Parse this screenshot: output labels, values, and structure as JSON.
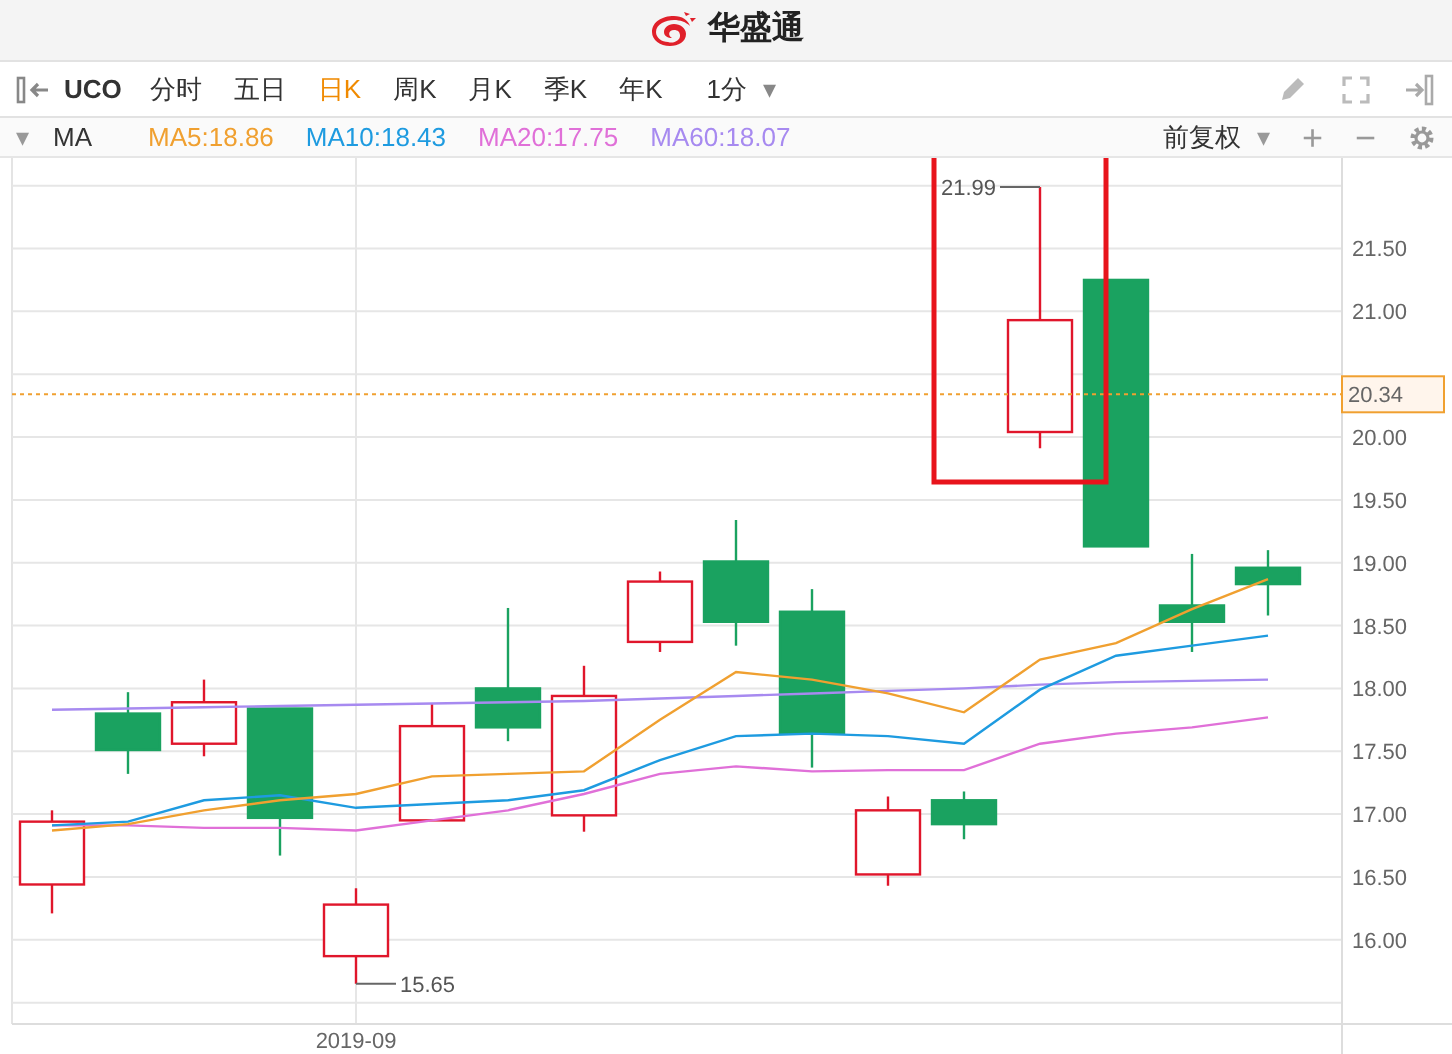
{
  "header": {
    "logo_text": "华盛通"
  },
  "toolbar": {
    "symbol": "UCO",
    "tabs": [
      {
        "label": "分时",
        "selected": false
      },
      {
        "label": "五日",
        "selected": false
      },
      {
        "label": "日K",
        "selected": true
      },
      {
        "label": "周K",
        "selected": false
      },
      {
        "label": "月K",
        "selected": false
      },
      {
        "label": "季K",
        "selected": false
      },
      {
        "label": "年K",
        "selected": false
      }
    ],
    "interval": "1分",
    "interval_caret": "▾"
  },
  "indicator_bar": {
    "caret": "▾",
    "name": "MA",
    "legend_values": [
      ":18.86",
      ":18.43",
      ":17.75",
      ":18.07"
    ],
    "adjust": "前复权",
    "adjust_caret": "▾",
    "plus": "+",
    "minus": "−"
  },
  "chart": {
    "date_label": "2019-09",
    "high_label": "21.99",
    "low_label": "15.65",
    "chart_data": {
      "type": "line",
      "ylim": [
        15.33,
        22.22
      ],
      "grid": true,
      "yticks": [
        {
          "value": 16,
          "label": "16.00"
        },
        {
          "value": 16.5,
          "label": "16.50"
        },
        {
          "value": 17,
          "label": "17.00"
        },
        {
          "value": 17.5,
          "label": "17.50"
        },
        {
          "value": 18,
          "label": "18.00"
        },
        {
          "value": 18.5,
          "label": "18.50"
        },
        {
          "value": 19,
          "label": "19.00"
        },
        {
          "value": 19.5,
          "label": "19.50"
        },
        {
          "value": 20,
          "label": "20.00"
        },
        {
          "value": 21,
          "label": "21.00"
        },
        {
          "value": 21.5,
          "label": "21.50"
        }
      ],
      "series": [
        {
          "name": "MA5",
          "color": "#f0a030",
          "values": [
            16.87,
            16.92,
            17.03,
            17.11,
            17.16,
            17.3,
            17.32,
            17.34,
            17.75,
            18.13,
            18.07,
            17.96,
            17.81,
            18.23,
            18.36,
            18.63,
            18.87
          ]
        },
        {
          "name": "MA10",
          "color": "#1e9be0",
          "values": [
            16.91,
            16.94,
            17.11,
            17.15,
            17.05,
            17.08,
            17.11,
            17.19,
            17.43,
            17.62,
            17.64,
            17.62,
            17.56,
            17.99,
            18.26,
            18.34,
            18.42
          ]
        },
        {
          "name": "MA20",
          "color": "#e070d8",
          "values": [
            16.91,
            16.91,
            16.89,
            16.89,
            16.87,
            16.95,
            17.03,
            17.16,
            17.32,
            17.38,
            17.34,
            17.35,
            17.35,
            17.56,
            17.64,
            17.69,
            17.77
          ]
        },
        {
          "name": "MA60",
          "color": "#a78af0",
          "values": [
            17.83,
            17.84,
            17.85,
            17.86,
            17.87,
            17.88,
            17.89,
            17.9,
            17.92,
            17.94,
            17.96,
            17.98,
            18.0,
            18.03,
            18.05,
            18.06,
            18.07
          ]
        }
      ],
      "ref_lines": [
        {
          "axis": "y",
          "value": 20.34,
          "label": "20.34"
        }
      ]
    }
  }
}
